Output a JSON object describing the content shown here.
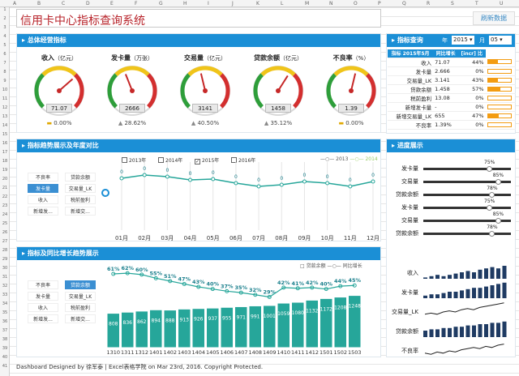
{
  "title": "信用卡中心指标查询系统",
  "refresh_label": "刷新数据",
  "columns": [
    "A",
    "B",
    "C",
    "D",
    "E",
    "F",
    "G",
    "H",
    "I",
    "J",
    "K",
    "L",
    "M",
    "N",
    "O",
    "P",
    "Q",
    "R",
    "S",
    "T",
    "U"
  ],
  "rows": [
    "1",
    "2",
    "3",
    "4",
    "5",
    "6",
    "7",
    "8",
    "9",
    "10",
    "11",
    "12",
    "13",
    "14",
    "15",
    "16",
    "17",
    "18",
    "19",
    "20",
    "21",
    "22",
    "23",
    "24",
    "25",
    "26",
    "27",
    "28",
    "29",
    "30",
    "31",
    "32",
    "33",
    "34",
    "35",
    "36",
    "37",
    "38",
    "39",
    "40",
    "41"
  ],
  "overview": {
    "title": "总体经营指标",
    "gauges": [
      {
        "label": "收入",
        "unit": "（亿元）",
        "value": "71.07",
        "change": "0.00%",
        "trend": "flat",
        "level": 0.68
      },
      {
        "label": "发卡量",
        "unit": "（万张）",
        "value": "2666",
        "change": "28.62%",
        "trend": "up",
        "level": 0.42
      },
      {
        "label": "交易量",
        "unit": "（亿元）",
        "value": "3141",
        "change": "40.50%",
        "trend": "up",
        "level": 0.45
      },
      {
        "label": "贷款余额",
        "unit": "（亿元）",
        "value": "1458",
        "change": "35.12%",
        "trend": "up",
        "level": 0.62
      },
      {
        "label": "不良率",
        "unit": "（%）",
        "value": "1.39",
        "change": "0.00%",
        "trend": "flat",
        "level": 0.55
      }
    ]
  },
  "query": {
    "title": "指标查询",
    "year_label": "年",
    "year": "2015",
    "month_label": "月",
    "month": "05",
    "headers": [
      "指标 2015年5月",
      "同比增长",
      "[incr] 比"
    ],
    "rows": [
      {
        "name": "收入",
        "value": "71.07",
        "growth": "44%",
        "bar": 0.44
      },
      {
        "name": "发卡量",
        "value": "2.666",
        "growth": "0%",
        "bar": 0.0
      },
      {
        "name": "交易量_LK",
        "value": "3.141",
        "growth": "43%",
        "bar": 0.43
      },
      {
        "name": "贷款余额",
        "value": "1.458",
        "growth": "57%",
        "bar": 0.57
      },
      {
        "name": "税前盈利",
        "value": "13.08",
        "growth": "0%",
        "bar": 0.0
      },
      {
        "name": "新增发卡量",
        "value": "-",
        "growth": "0%",
        "bar": 0.0
      },
      {
        "name": "新增交易量_LK",
        "value": "655",
        "growth": "47%",
        "bar": 0.47
      },
      {
        "name": "不良率",
        "value": "1.39%",
        "growth": "0%",
        "bar": 0.0
      }
    ]
  },
  "trend": {
    "title": "指标趋势展示及年度对比",
    "years": [
      {
        "label": "2013年",
        "checked": false
      },
      {
        "label": "2014年",
        "checked": false
      },
      {
        "label": "2015年",
        "checked": true
      },
      {
        "label": "2016年",
        "checked": false
      }
    ],
    "legend": [
      "2013",
      "2014"
    ],
    "slicers": [
      "不良率",
      "贷款余额",
      "发卡量",
      "交易量_LK",
      "收入",
      "税前盈利",
      "新增发...",
      "新增交..."
    ],
    "selected": "发卡量"
  },
  "growth": {
    "title": "指标及同比增长趋势展示",
    "legend": [
      "贷款余额",
      "同比增长"
    ],
    "slicers": [
      "不良率",
      "贷款余额",
      "发卡量",
      "交易量_LK",
      "收入",
      "税前盈利",
      "新增发...",
      "新增交..."
    ],
    "selected": "贷款余额"
  },
  "progress": {
    "title": "进度展示",
    "items": [
      {
        "label": "发卡量",
        "pct": 0.75,
        "text": "75%"
      },
      {
        "label": "交易量",
        "pct": 0.85,
        "text": "85%"
      },
      {
        "label": "贷款余额",
        "pct": 0.78,
        "text": "78%"
      },
      {
        "label": "发卡量",
        "pct": 0.75,
        "text": "75%"
      },
      {
        "label": "交易量",
        "pct": 0.85,
        "text": "85%"
      },
      {
        "label": "贷款余额",
        "pct": 0.78,
        "text": "78%"
      }
    ],
    "sparks": [
      "收入",
      "发卡量",
      "交易量_LK",
      "贷款余额",
      "不良率"
    ]
  },
  "footer": "Dashboard Designed by 徐军泰 | Excel表格学院 on Mar 23rd, 2016.  Copyright Protected.",
  "chart_data": [
    {
      "type": "line",
      "title": "指标趋势展示及年度对比",
      "categories": [
        "01月",
        "02月",
        "03月",
        "04月",
        "05月",
        "06月",
        "07月",
        "08月",
        "09月",
        "10月",
        "11月",
        "12月"
      ],
      "series": [
        {
          "name": "2015",
          "values": [
            0,
            0,
            0,
            0,
            0,
            null,
            null,
            null,
            null,
            null,
            null,
            null
          ]
        },
        {
          "name": "2014",
          "values": [
            0,
            0,
            0,
            0,
            0,
            0,
            0,
            0,
            0,
            0,
            0,
            0
          ]
        }
      ],
      "ylim": [
        0,
        1
      ]
    },
    {
      "type": "bar",
      "title": "指标及同比增长趋势展示",
      "categories": [
        "1310",
        "1311",
        "1312",
        "1401",
        "1402",
        "1403",
        "1404",
        "1405",
        "1406",
        "1407",
        "1408",
        "1409",
        "1410",
        "1411",
        "1412",
        "1501",
        "1502",
        "1503"
      ],
      "series": [
        {
          "name": "贷款余额",
          "values": [
            808,
            836,
            862,
            894,
            888,
            913,
            926,
            937,
            955,
            971,
            991,
            1001,
            1059,
            1080,
            1132,
            1172,
            1208,
            1248
          ]
        },
        {
          "name": "同比增长",
          "values": [
            61,
            62,
            60,
            55,
            51,
            47,
            43,
            40,
            37,
            35,
            32,
            29,
            42,
            41,
            42,
            40,
            44,
            45
          ]
        }
      ]
    }
  ]
}
